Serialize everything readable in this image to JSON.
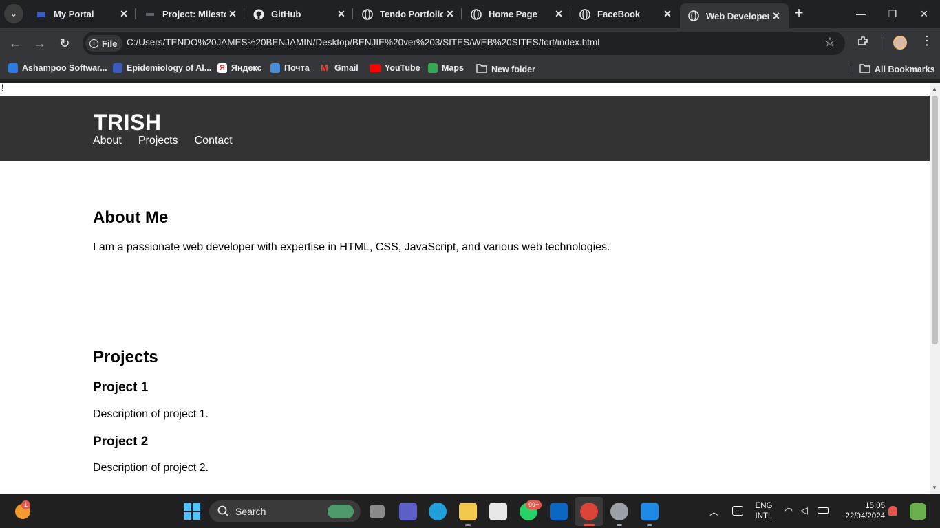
{
  "browser": {
    "tabs": [
      {
        "title": "My Portal",
        "icon": "portal-icon"
      },
      {
        "title": "Project: Milestone",
        "icon": "project-icon"
      },
      {
        "title": "GitHub",
        "icon": "github-icon"
      },
      {
        "title": "Tendo Portfolio",
        "icon": "globe-icon"
      },
      {
        "title": "Home Page",
        "icon": "globe-icon"
      },
      {
        "title": "FaceBook",
        "icon": "globe-icon"
      },
      {
        "title": "Web Developer",
        "icon": "globe-icon"
      }
    ],
    "active_tab_index": 6,
    "omnibox": {
      "scheme_label": "File",
      "url": "C:/Users/TENDO%20JAMES%20BENJAMIN/Desktop/BENJIE%20ver%203/SITES/WEB%20SITES/fort/index.html"
    },
    "bookmarks": [
      {
        "label": "Ashampoo Softwar...",
        "color": "#2d7be0"
      },
      {
        "label": "Epidemiology of Al...",
        "color": "#3b5bbf"
      },
      {
        "label": "Яндекс",
        "color": "#e53935"
      },
      {
        "label": "Почта",
        "color": "#4a90d9"
      },
      {
        "label": "Gmail",
        "color": "#ea4335"
      },
      {
        "label": "YouTube",
        "color": "#ff0000"
      },
      {
        "label": "Maps",
        "color": "#34a853"
      },
      {
        "label": "New folder",
        "color": "#e8eaed"
      }
    ],
    "all_bookmarks_label": "All Bookmarks"
  },
  "page": {
    "stray_char": "!",
    "header": {
      "brand": "TRISH",
      "nav": [
        "About",
        "Projects",
        "Contact"
      ]
    },
    "about": {
      "title": "About Me",
      "text": "I am a passionate web developer with expertise in HTML, CSS, JavaScript, and various web technologies."
    },
    "projects": {
      "title": "Projects",
      "items": [
        {
          "title": "Project 1",
          "description": "Description of project 1."
        },
        {
          "title": "Project 2",
          "description": "Description of project 2."
        }
      ]
    },
    "colors": {
      "header_bg": "#333333",
      "header_text": "#ffffff",
      "body_text": "#000000"
    }
  },
  "taskbar": {
    "search_label": "Search",
    "notification_badge": "1",
    "whatsapp_badge": "99+",
    "lang_top": "ENG",
    "lang_bottom": "INTL",
    "time": "15:05",
    "date": "22/04/2024"
  }
}
